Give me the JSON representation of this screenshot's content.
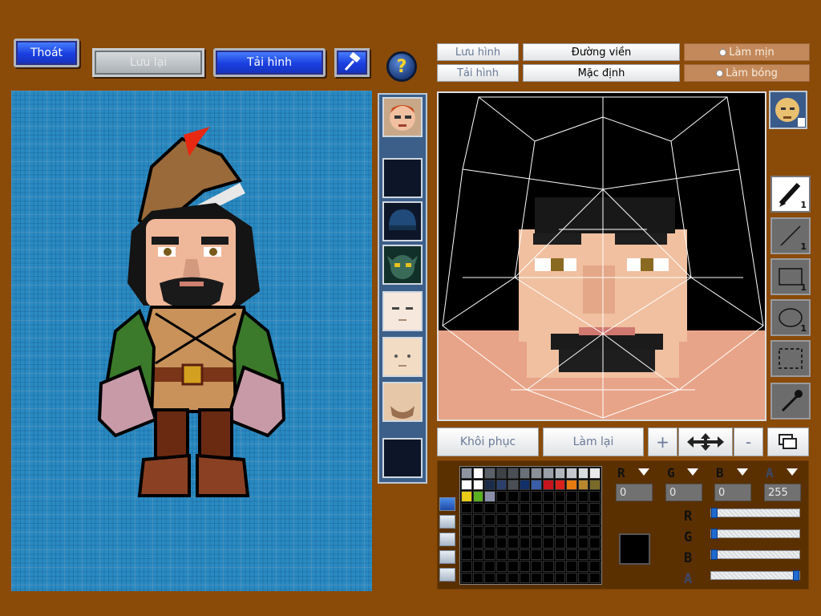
{
  "toolbar": {
    "exit_label": "Thoát",
    "save_label": "Lưu lại",
    "reload_label": "Tải hình",
    "help_label": "?"
  },
  "editor_tabs": {
    "save_image": "Lưu hình",
    "load_image": "Tải hình",
    "outline": "Đường viền",
    "default": "Mặc định",
    "smooth": "Làm mịn",
    "shine": "Làm bóng"
  },
  "thumbnails": [
    "hero-face",
    "empty",
    "helmet",
    "goblin",
    "face-white",
    "face-beige",
    "face-beard",
    "empty"
  ],
  "tools": [
    {
      "name": "pen-tool",
      "count": "1",
      "active": true
    },
    {
      "name": "line-tool",
      "count": "1",
      "active": false
    },
    {
      "name": "rectangle-tool",
      "count": "1",
      "active": false
    },
    {
      "name": "ellipse-tool",
      "count": "1",
      "active": false
    },
    {
      "name": "selection-tool",
      "count": "",
      "active": false
    },
    {
      "name": "eyedropper-tool",
      "count": "",
      "active": false
    }
  ],
  "bottom_buttons": {
    "restore": "Khôi phục",
    "redo": "Làm lại",
    "plus": "+",
    "minus": "-"
  },
  "color": {
    "channels": [
      "R",
      "G",
      "B",
      "A"
    ],
    "values": {
      "r": "0",
      "g": "0",
      "b": "0",
      "a": "255"
    },
    "slider_fraction": {
      "r": 0,
      "g": 0,
      "b": 0,
      "a": 1
    },
    "current": "#000000",
    "palette": [
      "#8d96a0",
      "#ffffff",
      "#5b6168",
      "#3d4247",
      "#4a4f55",
      "#6a7078",
      "#8a9098",
      "#9aa0a8",
      "#b0b6bc",
      "#c4c8cc",
      "#d8dcdf",
      "#e8eaec",
      "#ffffff",
      "#ffffff",
      "#1b2c4a",
      "#2a3f6a",
      "#4a4f55",
      "#12306a",
      "#3a5fa8",
      "#c4141c",
      "#d9201a",
      "#e87a12",
      "#b8862c",
      "#7a6a28",
      "#e8cc18",
      "#5bb020",
      "#8a8ea8"
    ]
  },
  "colors": {
    "background": "#8a4a08",
    "accent_blue": "#1a3ee0",
    "preview_bg": "#2a8ac2"
  }
}
